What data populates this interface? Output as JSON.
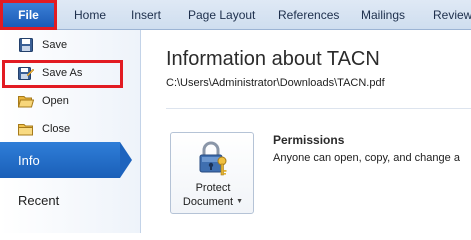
{
  "ribbon": {
    "file_label": "File",
    "tabs": [
      "Home",
      "Insert",
      "Page Layout",
      "References",
      "Mailings",
      "Review"
    ]
  },
  "backstage": {
    "items": [
      {
        "label": "Save",
        "icon": "save-icon"
      },
      {
        "label": "Save As",
        "icon": "save-as-icon"
      },
      {
        "label": "Open",
        "icon": "open-folder-icon"
      },
      {
        "label": "Close",
        "icon": "close-folder-icon"
      }
    ],
    "info_label": "Info",
    "recent_label": "Recent"
  },
  "info": {
    "title": "Information about TACN",
    "path": "C:\\Users\\Administrator\\Downloads\\TACN.pdf",
    "protect_label_line1": "Protect",
    "protect_label_line2": "Document",
    "permissions_title": "Permissions",
    "permissions_desc": "Anyone can open, copy, and change a"
  },
  "colors": {
    "highlight_box": "#e21b22",
    "accent_blue": "#1d63be"
  }
}
